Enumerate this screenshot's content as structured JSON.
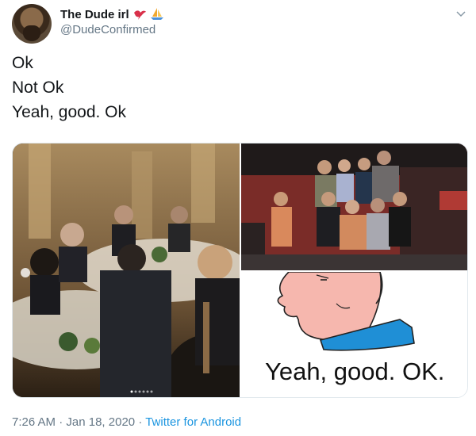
{
  "author": {
    "display_name": "The Dude irl",
    "handle": "@DudeConfirmed",
    "badges": [
      "bird-emoji-icon",
      "sailboat-emoji-icon"
    ]
  },
  "tweet": {
    "lines": [
      "Ok",
      "Not Ok",
      "Yeah, good. Ok"
    ]
  },
  "media": {
    "meme_caption": "Yeah, good. OK.",
    "images": [
      "banquet-photo",
      "group-photo",
      "meme-illustration"
    ]
  },
  "footer": {
    "time": "7:26 AM",
    "separator": "·",
    "date": "Jan 18, 2020",
    "source": "Twitter for Android"
  },
  "colors": {
    "text_primary": "#14171a",
    "text_secondary": "#657786",
    "link": "#1b95e0"
  }
}
